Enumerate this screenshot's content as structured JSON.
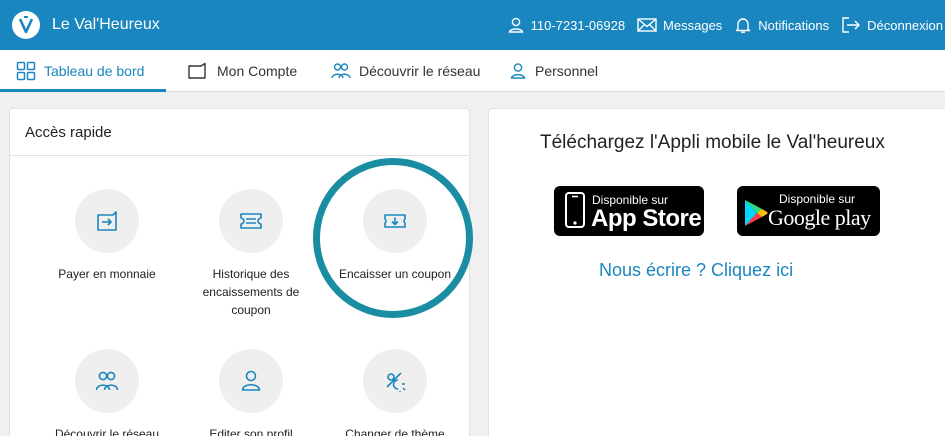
{
  "header": {
    "app_title": "Le Val'Heureux",
    "account_number": "110-7231-06928",
    "messages": "Messages",
    "notifications": "Notifications",
    "logout": "Déconnexion"
  },
  "tabs": [
    {
      "label": "Tableau de bord",
      "active": true
    },
    {
      "label": "Mon Compte"
    },
    {
      "label": "Découvrir le réseau"
    },
    {
      "label": "Personnel"
    }
  ],
  "quick_access": {
    "title": "Accès rapide",
    "items": [
      {
        "label": "Payer en monnaie",
        "icon": "wallet-arrow-icon"
      },
      {
        "label": "Historique des encaissements de coupon",
        "icon": "coupon-list-icon"
      },
      {
        "label": "Encaisser un coupon",
        "icon": "coupon-download-icon",
        "highlighted": true
      },
      {
        "label": "Découvrir le réseau",
        "icon": "people-icon"
      },
      {
        "label": "Editer son profil",
        "icon": "user-icon"
      },
      {
        "label": "Changer de thème",
        "icon": "theme-icon"
      }
    ]
  },
  "download": {
    "title": "Téléchargez l'Appli mobile le Val'heureux",
    "appstore_small": "Disponible sur",
    "appstore_big": "App Store",
    "googleplay_small": "Disponible sur",
    "googleplay_big": "Google play",
    "contact": "Nous écrire ? Cliquez ici"
  },
  "colors": {
    "primary": "#1a86bf",
    "highlight_ring": "#1a8da3"
  }
}
